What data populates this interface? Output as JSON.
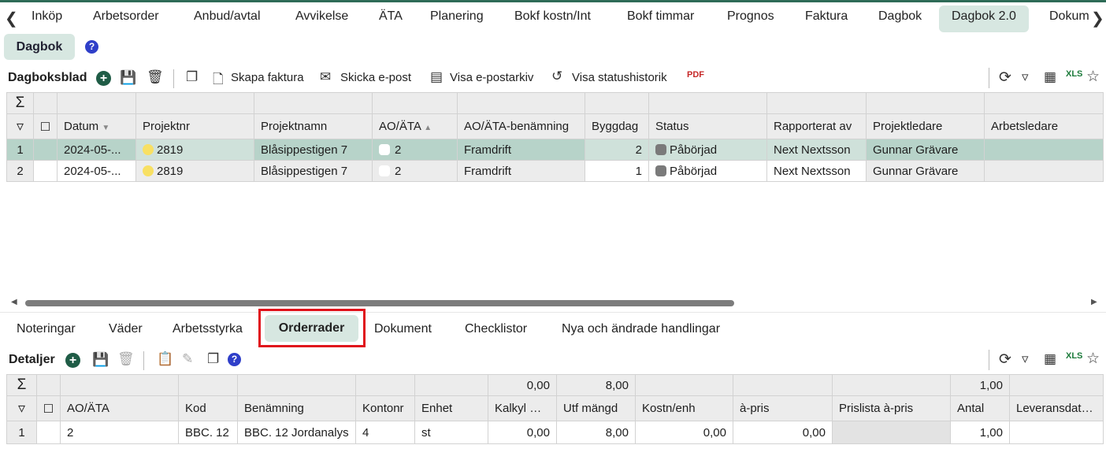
{
  "top_tabs": [
    "Inköp",
    "Arbetsorder",
    "Anbud/avtal",
    "Avvikelse",
    "ÄTA",
    "Planering",
    "Bokf kostn/Int",
    "Bokf timmar",
    "Prognos",
    "Faktura",
    "Dagbok",
    "Dagbok 2.0",
    "Dokum"
  ],
  "page_pill": "Dagbok",
  "toolbar": {
    "title": "Dagboksblad",
    "skapa_faktura": "Skapa faktura",
    "skicka_epost": "Skicka e-post",
    "visa_epostarkiv": "Visa e-postarkiv",
    "visa_statushistorik": "Visa statushistorik"
  },
  "main_grid": {
    "columns": [
      "Datum",
      "Projektnr",
      "Projektnamn",
      "AO/ÄTA",
      "AO/ÄTA-benämning",
      "Byggdag",
      "Status",
      "Rapporterat av",
      "Projektledare",
      "Arbetsledare"
    ],
    "rows": [
      {
        "n": "1",
        "datum": "2024-05-...",
        "projektnr": "2819",
        "projektnamn": "Blåsippestigen 7",
        "ao": "2",
        "ao_ben": "Framdrift",
        "byggdag": "2",
        "status": "Påbörjad",
        "rapporterat": "Next Nextsson",
        "projektledare": "Gunnar Grävare",
        "arbetsledare": ""
      },
      {
        "n": "2",
        "datum": "2024-05-...",
        "projektnr": "2819",
        "projektnamn": "Blåsippestigen 7",
        "ao": "2",
        "ao_ben": "Framdrift",
        "byggdag": "1",
        "status": "Påbörjad",
        "rapporterat": "Next Nextsson",
        "projektledare": "Gunnar Grävare",
        "arbetsledare": ""
      }
    ]
  },
  "bottom_tabs": [
    "Noteringar",
    "Väder",
    "Arbetsstyrka",
    "Orderrader",
    "Dokument",
    "Checklistor",
    "Nya och ändrade handlingar"
  ],
  "details": {
    "title": "Detaljer",
    "sums": {
      "kalkyl": "0,00",
      "utf": "8,00",
      "antal": "1,00"
    },
    "columns": [
      "AO/ÄTA",
      "Kod",
      "Benämning",
      "Kontonr",
      "Enhet",
      "Kalkyl mgd",
      "Utf mängd",
      "Kostn/enh",
      "à-pris",
      "Prislista à-pris",
      "Antal",
      "Leveransdatum"
    ],
    "rows": [
      {
        "n": "1",
        "ao": "2",
        "kod": "BBC. 12",
        "ben": "BBC. 12 Jordanalys",
        "konto": "4",
        "enhet": "st",
        "kalkyl": "0,00",
        "utf": "8,00",
        "kostn": "0,00",
        "apris": "0,00",
        "prislista": "",
        "antal": "1,00",
        "lev": ""
      }
    ]
  }
}
